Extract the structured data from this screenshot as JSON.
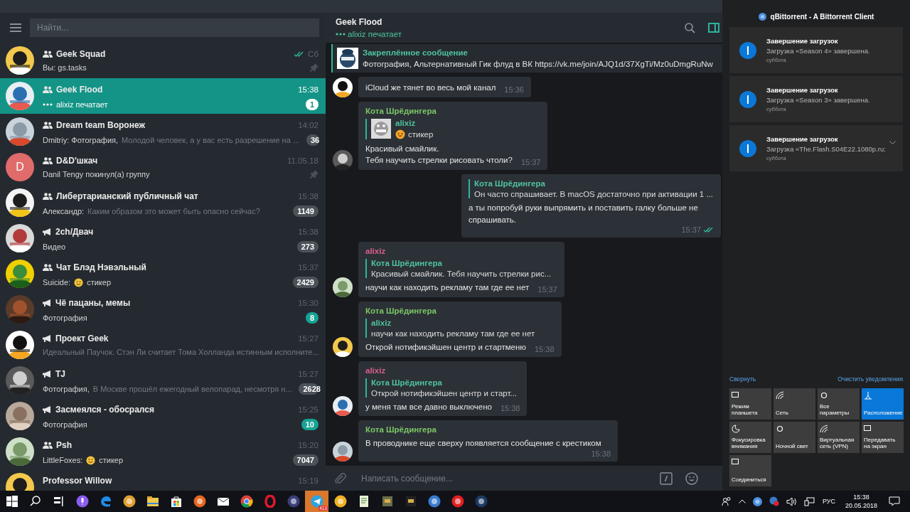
{
  "sidebar": {
    "search": {
      "placeholder": "Найти..."
    },
    "chats": [
      {
        "name": "Geek Squad",
        "kind": "group",
        "time": "Сб",
        "read": true,
        "pinned": true,
        "typing": false,
        "selected": false,
        "preview": [
          {
            "kind": "text",
            "text": "Вы: gs.tasks",
            "dim": false
          }
        ]
      },
      {
        "name": "Geek Flood",
        "kind": "group",
        "time": "15:38",
        "read": false,
        "pinned": false,
        "typing": true,
        "selected": true,
        "preview": [
          {
            "kind": "text",
            "text": "alixiz печатает",
            "dim": false
          }
        ],
        "badge": {
          "count": "1",
          "muted": false
        }
      },
      {
        "name": "Dream team Воронеж",
        "kind": "group",
        "time": "14:02",
        "read": false,
        "pinned": false,
        "typing": false,
        "selected": false,
        "preview": [
          {
            "kind": "text",
            "text": "Dmitriy: Фотография,",
            "dim": false
          },
          {
            "kind": "text",
            "text": "Молодой человек, а у вас есть разрешение на ...",
            "dim": true
          }
        ],
        "badge": {
          "count": "36",
          "muted": true
        }
      },
      {
        "name": "D&D'шкач",
        "kind": "group",
        "time": "11.05.18",
        "read": false,
        "pinned": true,
        "typing": false,
        "selected": false,
        "letter": "D",
        "preview": [
          {
            "kind": "text",
            "text": "Danil Tengy покинул(а) группу",
            "dim": false
          }
        ]
      },
      {
        "name": "Либертарианский публичный чат",
        "kind": "group",
        "time": "15:38",
        "read": false,
        "pinned": false,
        "typing": false,
        "selected": false,
        "preview": [
          {
            "kind": "text",
            "text": "Александр:",
            "dim": false
          },
          {
            "kind": "text",
            "text": "Каким образом это может быть опасно сейчас?",
            "dim": true
          }
        ],
        "badge": {
          "count": "1149",
          "muted": true
        }
      },
      {
        "name": "2ch/Двач",
        "kind": "channel",
        "time": "15:38",
        "read": false,
        "pinned": false,
        "typing": false,
        "selected": false,
        "preview": [
          {
            "kind": "text",
            "text": "Видео",
            "dim": false
          }
        ],
        "badge": {
          "count": "273",
          "muted": true
        }
      },
      {
        "name": "Чат Блэд Нэвэльный",
        "kind": "group",
        "time": "15:37",
        "read": false,
        "pinned": false,
        "typing": false,
        "selected": false,
        "preview": [
          {
            "kind": "text",
            "text": "Suicide:",
            "dim": false
          },
          {
            "kind": "emoji"
          },
          {
            "kind": "text",
            "text": "стикер",
            "dim": false
          }
        ],
        "badge": {
          "count": "2429",
          "muted": true
        }
      },
      {
        "name": "Чё пацаны, мемы",
        "kind": "channel",
        "time": "15:30",
        "read": false,
        "pinned": false,
        "typing": false,
        "selected": false,
        "preview": [
          {
            "kind": "text",
            "text": "Фотография",
            "dim": false
          }
        ],
        "badge": {
          "count": "8",
          "muted": false
        }
      },
      {
        "name": "Проект Geek",
        "kind": "channel",
        "time": "15:27",
        "read": false,
        "pinned": false,
        "typing": false,
        "selected": false,
        "preview": [
          {
            "kind": "text",
            "text": "Идеальный Паучок.  Стэн Ли считает Тома Холланда истинным исполните...",
            "dim": true
          }
        ]
      },
      {
        "name": "TJ",
        "kind": "channel",
        "time": "15:27",
        "read": false,
        "pinned": false,
        "typing": false,
        "selected": false,
        "preview": [
          {
            "kind": "text",
            "text": "Фотография,",
            "dim": false
          },
          {
            "kind": "text",
            "text": "В Москве прошёл ежегодный велопарад, несмотря н...",
            "dim": true
          }
        ],
        "badge": {
          "count": "2628",
          "muted": true
        }
      },
      {
        "name": "Засмеялся - обосрался",
        "kind": "channel",
        "time": "15:25",
        "read": false,
        "pinned": false,
        "typing": false,
        "selected": false,
        "preview": [
          {
            "kind": "text",
            "text": "Фотография",
            "dim": false
          }
        ],
        "badge": {
          "count": "10",
          "muted": false
        }
      },
      {
        "name": "Psh",
        "kind": "group",
        "time": "15:20",
        "read": false,
        "pinned": false,
        "typing": false,
        "selected": false,
        "preview": [
          {
            "kind": "text",
            "text": "LittleFoxes:",
            "dim": false
          },
          {
            "kind": "emoji"
          },
          {
            "kind": "text",
            "text": "стикер",
            "dim": false
          }
        ],
        "badge": {
          "count": "7047",
          "muted": true
        }
      },
      {
        "name": "Professor Willow",
        "kind": "none",
        "time": "15:19",
        "read": false,
        "pinned": false,
        "typing": false,
        "selected": false
      }
    ]
  },
  "chat": {
    "title": "Geek Flood",
    "status": "alixiz печатает",
    "pinned": {
      "title": "Закреплённое сообщение",
      "text": "Фотография, Альтернативный Гик флуд в ВК https://vk.me/join/AJQ1d/37XgTi/Mz0uDmgRuNw"
    },
    "messages": [
      {
        "kind": "in",
        "text": "iCloud же тянет во весь мой канал",
        "time": "15:36"
      },
      {
        "kind": "in",
        "sender": "Кота Шрёдингера",
        "color": "#7cc766",
        "reply": {
          "author": "alixiz",
          "thumbnail": true,
          "parts": [
            {
              "kind": "emoji"
            },
            {
              "kind": "text",
              "text": "стикер"
            }
          ]
        },
        "text": "Красивый смайлик.\nТебя научить стрелки рисовать чтоли?",
        "time": "15:37"
      },
      {
        "kind": "out",
        "reply": {
          "author": "Кота Шрёдингера",
          "thumbnail": false,
          "parts": [
            {
              "kind": "text",
              "text": "Он часто спрашивает. В macOS достаточно при активации 1 ..."
            }
          ]
        },
        "text": "а ты попробуй руки выпрямить и поставить галку больше не спрашивать.",
        "time": "15:37",
        "read": true
      },
      {
        "kind": "in",
        "sender": "alixiz",
        "color": "#d9608a",
        "reply": {
          "author": "Кота Шрёдингера",
          "thumbnail": false,
          "parts": [
            {
              "kind": "text",
              "text": "Красивый смайлик. Тебя научить стрелки рис..."
            }
          ]
        },
        "text": "научи как находить рекламу там где ее нет",
        "time": "15:37"
      },
      {
        "kind": "in",
        "sender": "Кота Шрёдингера",
        "color": "#7cc766",
        "reply": {
          "author": "alixiz",
          "thumbnail": false,
          "parts": [
            {
              "kind": "text",
              "text": "научи как находить рекламу там где ее нет"
            }
          ]
        },
        "text": "Открой нотификэйшен центр и стартменю",
        "time": "15:38"
      },
      {
        "kind": "in",
        "sender": "alixiz",
        "color": "#d9608a",
        "reply": {
          "author": "Кота Шрёдингера",
          "thumbnail": false,
          "parts": [
            {
              "kind": "text",
              "text": "Открой нотификэйшен центр и старт..."
            }
          ]
        },
        "text": "у меня там все давно выключено",
        "time": "15:38"
      },
      {
        "kind": "in",
        "sender": "Кота Шрёдингера",
        "color": "#7cc766",
        "text": "В проводнике еще сверху появляется сообщение с крестиком",
        "time": "15:38"
      }
    ],
    "composer": {
      "placeholder": "Написать сообщение..."
    }
  },
  "action_center": {
    "app": "qBittorrent - A Bittorrent Client",
    "notifications": [
      {
        "title": "Завершение загрузок",
        "body": "Загрузка «Season 4» завершена.",
        "time": "суббота",
        "expandable": false
      },
      {
        "title": "Завершение загрузок",
        "body": "Загрузка «Season 3» завершена.",
        "time": "суббота",
        "expandable": false
      },
      {
        "title": "Завершение загрузок",
        "body": "Загрузка «The.Flash.S04E22.1080p.ru:",
        "time": "суббота",
        "expandable": true
      }
    ],
    "collapse": "Свернуть",
    "clear": "Очистить уведомления",
    "tiles": [
      {
        "label": "Режим планшета",
        "on": false
      },
      {
        "label": "Сеть",
        "on": false
      },
      {
        "label": "Все параметры",
        "on": false
      },
      {
        "label": "Расположение",
        "on": true
      },
      {
        "label": "Фокусировка внимания",
        "on": false
      },
      {
        "label": "Ночной свет",
        "on": false
      },
      {
        "label": "Виртуальная сеть (VPN)",
        "on": false
      },
      {
        "label": "Передавать на экран",
        "on": false
      },
      {
        "label": "Соединиться",
        "on": false
      }
    ]
  },
  "taskbar": {
    "apps": [
      {
        "selected": false
      },
      {
        "selected": false
      },
      {
        "selected": false
      },
      {
        "selected": false
      },
      {
        "selected": false
      },
      {
        "selected": false
      },
      {
        "selected": false
      },
      {
        "selected": false
      },
      {
        "selected": false
      },
      {
        "selected": false
      },
      {
        "selected": false
      },
      {
        "selected": false
      },
      {
        "selected": false
      },
      {
        "selected": true,
        "badge": "413"
      },
      {
        "selected": false
      },
      {
        "selected": false
      },
      {
        "selected": false
      },
      {
        "selected": false
      },
      {
        "selected": false
      },
      {
        "selected": false
      },
      {
        "selected": false
      }
    ],
    "tray": {
      "language": "РУС",
      "time": "15:38",
      "date": "20.05.2018"
    }
  }
}
